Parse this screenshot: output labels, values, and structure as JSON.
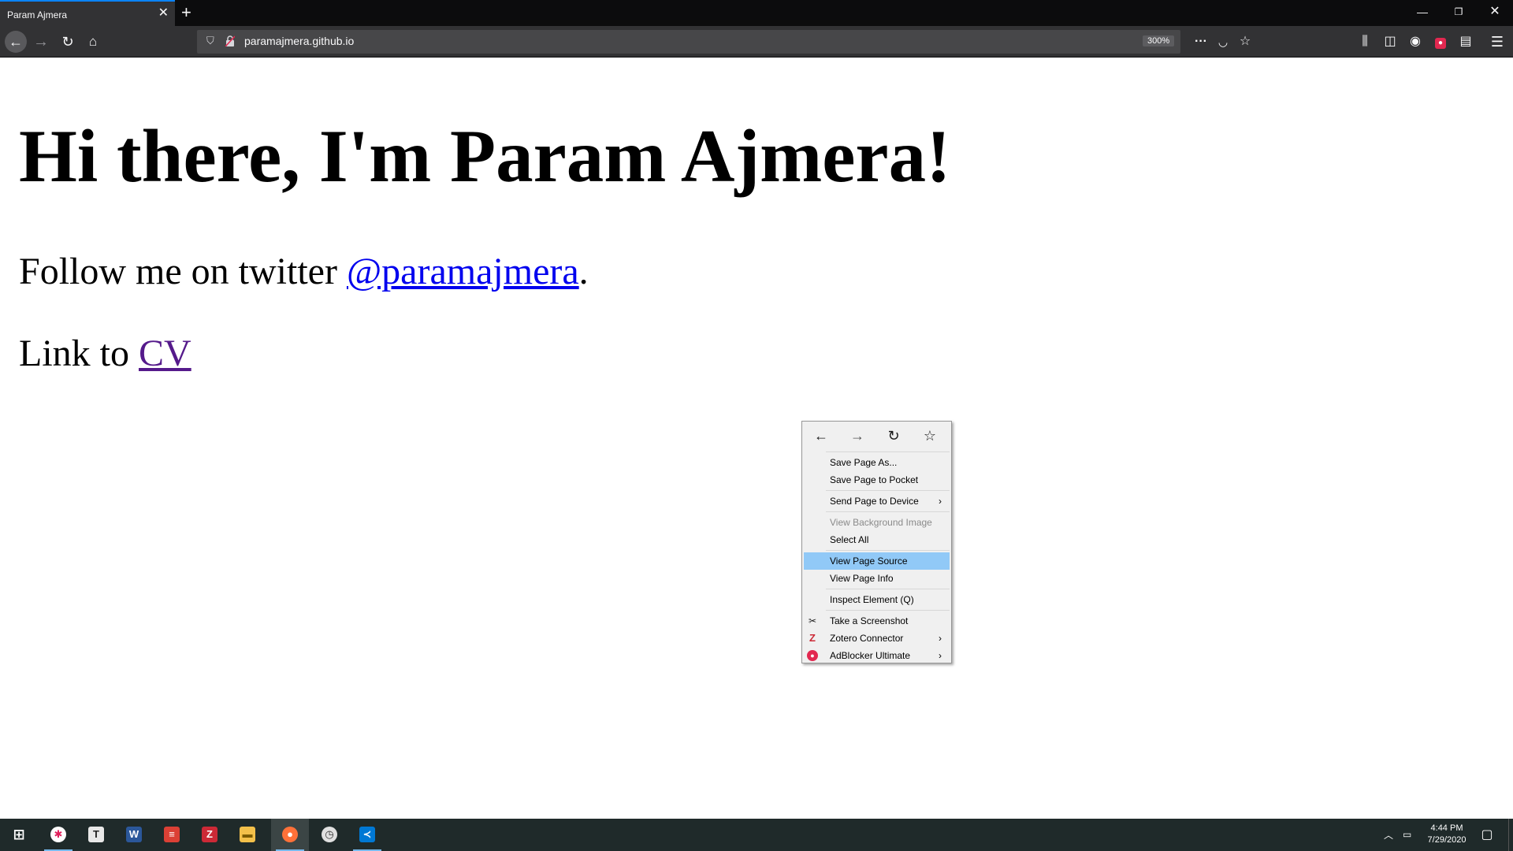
{
  "browser": {
    "tab_title": "Param Ajmera",
    "url": "paramajmera.github.io",
    "zoom": "300%"
  },
  "page": {
    "heading": "Hi there, I'm Param Ajmera!",
    "twitter_prefix": "Follow me on twitter ",
    "twitter_link": "@paramajmera",
    "twitter_suffix": ".",
    "cv_prefix": "Link to ",
    "cv_link": "CV"
  },
  "context_menu": {
    "items": [
      {
        "label": "Save Page As...",
        "icon": "",
        "submenu": false,
        "disabled": false,
        "highlight": false
      },
      {
        "label": "Save Page to Pocket",
        "icon": "",
        "submenu": false,
        "disabled": false,
        "highlight": false
      },
      {
        "label": "Send Page to Device",
        "icon": "",
        "submenu": true,
        "disabled": false,
        "highlight": false
      },
      {
        "label": "View Background Image",
        "icon": "",
        "submenu": false,
        "disabled": true,
        "highlight": false
      },
      {
        "label": "Select All",
        "icon": "",
        "submenu": false,
        "disabled": false,
        "highlight": false
      },
      {
        "label": "View Page Source",
        "icon": "",
        "submenu": false,
        "disabled": false,
        "highlight": true
      },
      {
        "label": "View Page Info",
        "icon": "",
        "submenu": false,
        "disabled": false,
        "highlight": false
      },
      {
        "label": "Inspect Element (Q)",
        "icon": "",
        "submenu": false,
        "disabled": false,
        "highlight": false
      },
      {
        "label": "Take a Screenshot",
        "icon": "scissors-icon",
        "submenu": false,
        "disabled": false,
        "highlight": false
      },
      {
        "label": "Zotero Connector",
        "icon": "zotero-icon",
        "submenu": true,
        "disabled": false,
        "highlight": false
      },
      {
        "label": "AdBlocker Ultimate",
        "icon": "adblocker-icon",
        "submenu": true,
        "disabled": false,
        "highlight": false
      }
    ]
  },
  "taskbar": {
    "apps": [
      {
        "name": "start",
        "icon": "windows-icon"
      },
      {
        "name": "slack",
        "icon": "slack-icon"
      },
      {
        "name": "typora",
        "icon": "typora-icon"
      },
      {
        "name": "word",
        "icon": "word-icon"
      },
      {
        "name": "todoist",
        "icon": "todoist-icon"
      },
      {
        "name": "zotero",
        "icon": "zotero-icon"
      },
      {
        "name": "file-explorer",
        "icon": "folder-icon"
      },
      {
        "name": "firefox",
        "icon": "firefox-icon"
      },
      {
        "name": "clock-app",
        "icon": "clock-icon"
      },
      {
        "name": "vscode",
        "icon": "vscode-icon"
      }
    ],
    "time": "4:44 PM",
    "date": "7/29/2020"
  },
  "colors": {
    "link_unvisited": "#0000ee",
    "link_visited": "#551a8b",
    "menu_highlight": "#91c9f7",
    "chrome_dark": "#323234",
    "taskbar": "#1f2a2a"
  }
}
